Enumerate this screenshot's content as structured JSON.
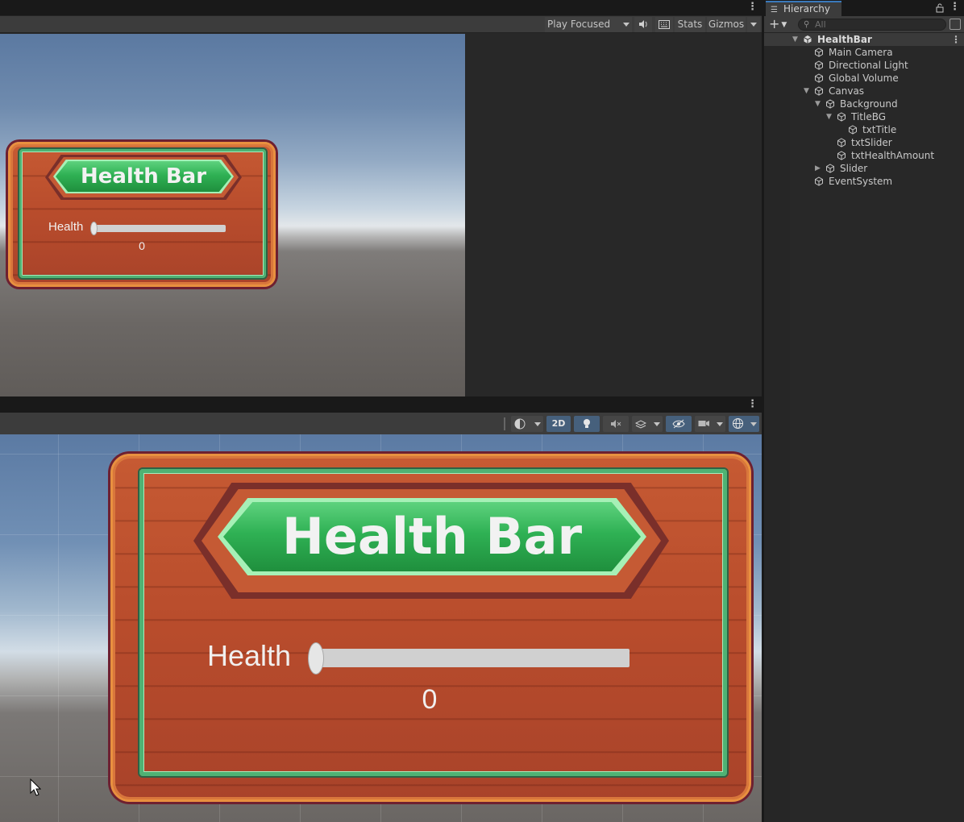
{
  "game_toolbar": {
    "play_mode": "Play Focused",
    "stats_label": "Stats",
    "gizmos_label": "Gizmos"
  },
  "scene_toolbar": {
    "mode_2d_label": "2D"
  },
  "ui_preview": {
    "title": "Health Bar",
    "health_label": "Health",
    "health_value": "0",
    "slider_fraction": 0
  },
  "hierarchy": {
    "tab_label": "Hierarchy",
    "search_placeholder": "All",
    "items": [
      {
        "label": "HealthBar",
        "depth": 0,
        "expanded": true,
        "is_scene": true
      },
      {
        "label": "Main Camera",
        "depth": 1
      },
      {
        "label": "Directional Light",
        "depth": 1
      },
      {
        "label": "Global Volume",
        "depth": 1
      },
      {
        "label": "Canvas",
        "depth": 1,
        "expanded": true
      },
      {
        "label": "Background",
        "depth": 2,
        "expanded": true
      },
      {
        "label": "TitleBG",
        "depth": 3,
        "expanded": true
      },
      {
        "label": "txtTitle",
        "depth": 4
      },
      {
        "label": "txtSlider",
        "depth": 3
      },
      {
        "label": "txtHealthAmount",
        "depth": 3
      },
      {
        "label": "Slider",
        "depth": 2,
        "expanded": false
      },
      {
        "label": "EventSystem",
        "depth": 1
      }
    ]
  },
  "colors": {
    "editor_bg": "#282828",
    "toolbar_bg": "#3c3c3c",
    "accent_blue": "#3a79bb",
    "banner_green": "#2fb154",
    "wood_orange": "#b84c2c"
  }
}
